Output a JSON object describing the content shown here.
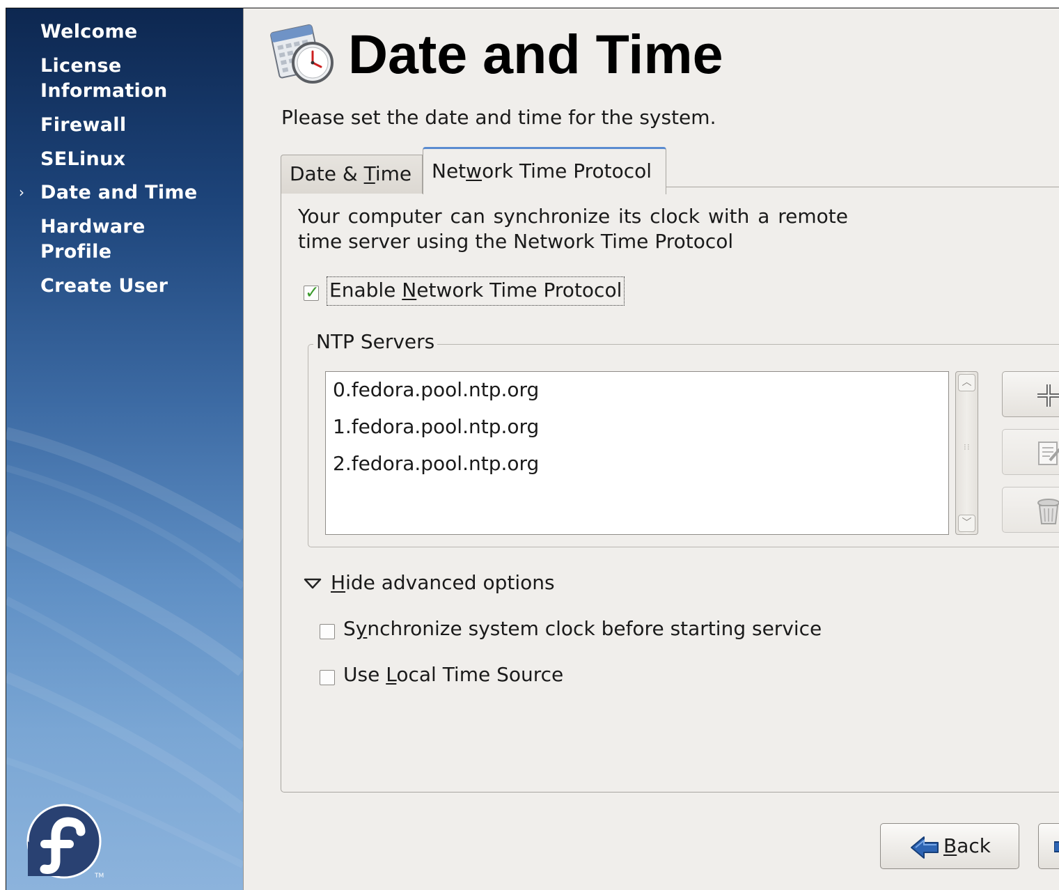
{
  "sidebar": {
    "items": [
      {
        "label": "Welcome"
      },
      {
        "label": "License"
      },
      {
        "label": "Information"
      },
      {
        "label": "Firewall"
      },
      {
        "label": "SELinux"
      },
      {
        "label": "Date and Time"
      },
      {
        "label": "Hardware"
      },
      {
        "label": "Profile"
      },
      {
        "label": "Create User"
      }
    ],
    "active_label": "Date and Time",
    "active_marker": "›",
    "logo_tm": "TM"
  },
  "header": {
    "title": "Date and Time",
    "subtitle": "Please set the date and time for the system.",
    "icon": "calendar-clock-icon"
  },
  "tabs": [
    {
      "label_pre": "Date & ",
      "mnemonic": "T",
      "label_post": "ime",
      "active": false
    },
    {
      "label_pre": "Net",
      "mnemonic": "w",
      "label_post": "ork Time Protocol",
      "active": true
    }
  ],
  "ntp_tab": {
    "description": "Your computer can synchronize its clock with a remote time server using the Network Time Protocol",
    "enable_ntp": {
      "label_pre": "Enable ",
      "mnemonic": "N",
      "label_post": "etwork Time Protocol",
      "checked": true
    },
    "servers_legend": "NTP Servers",
    "servers": [
      "0.fedora.pool.ntp.org",
      "1.fedora.pool.ntp.org",
      "2.fedora.pool.ntp.org"
    ],
    "advanced_toggle": {
      "mnemonic": "H",
      "label_post": "ide advanced options",
      "expanded": true
    },
    "sync_before_start": {
      "label_pre": "S",
      "mnemonic": "y",
      "label_post": "nchronize system clock before starting service",
      "checked": false
    },
    "use_local_source": {
      "label_pre": "Use ",
      "mnemonic": "L",
      "label_post": "ocal Time Source",
      "checked": false
    }
  },
  "buttons": {
    "back": {
      "mnemonic": "B",
      "label_post": "ack"
    }
  },
  "colors": {
    "accent": "#5a8bd0",
    "check": "#3a9a2b",
    "sidebar_top": "#0d2750",
    "sidebar_bottom": "#8cb3dc",
    "panel_bg": "#f0eeeb"
  }
}
